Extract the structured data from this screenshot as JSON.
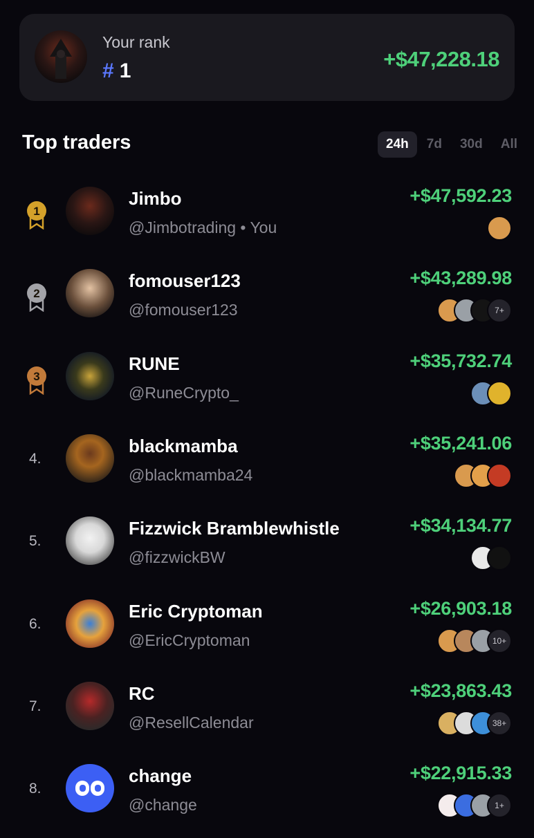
{
  "your_rank": {
    "label": "Your rank",
    "hash": "#",
    "rank": "1",
    "profit": "+$47,228.18"
  },
  "section": {
    "title": "Top traders",
    "tabs": [
      "24h",
      "7d",
      "30d",
      "All"
    ],
    "active_tab": "24h"
  },
  "colors": {
    "profit_green": "#4ed07a",
    "accent_blue": "#5b78ff",
    "gold": "#d4a12a",
    "silver": "#a3a3a8",
    "bronze": "#c27a3a"
  },
  "traders": [
    {
      "rank": "1",
      "medal": "gold",
      "name": "Jimbo",
      "handle": "@Jimbotrading • You",
      "profit": "+$47,592.23",
      "tokens": [
        "dog-token"
      ],
      "more": ""
    },
    {
      "rank": "2",
      "medal": "silver",
      "name": "fomouser123",
      "handle": "@fomouser123",
      "profit": "+$43,289.98",
      "tokens": [
        "dog-token",
        "cat-token",
        "fire-token"
      ],
      "more": "7+"
    },
    {
      "rank": "3",
      "medal": "bronze",
      "name": "RUNE",
      "handle": "@RuneCrypto_",
      "profit": "+$35,732.74",
      "tokens": [
        "bird-token",
        "coin-token"
      ],
      "more": ""
    },
    {
      "rank": "4.",
      "medal": "",
      "name": "blackmamba",
      "handle": "@blackmamba24",
      "profit": "+$35,241.06",
      "tokens": [
        "dog-token",
        "shiba-token",
        "red-token"
      ],
      "more": ""
    },
    {
      "rank": "5.",
      "medal": "",
      "name": "Fizzwick Bramblewhistle",
      "handle": "@fizzwickBW",
      "profit": "+$34,134.77",
      "tokens": [
        "checker-token",
        "ring-token"
      ],
      "more": ""
    },
    {
      "rank": "6.",
      "medal": "",
      "name": "Eric Cryptoman",
      "handle": "@EricCryptoman",
      "profit": "+$26,903.18",
      "tokens": [
        "dog-token",
        "bear-token",
        "cat-token"
      ],
      "more": "10+"
    },
    {
      "rank": "7.",
      "medal": "",
      "name": "RC",
      "handle": "@ResellCalendar",
      "profit": "+$23,863.43",
      "tokens": [
        "doge-token",
        "face-token",
        "minion-token"
      ],
      "more": "38+"
    },
    {
      "rank": "8.",
      "medal": "",
      "name": "change",
      "handle": "@change",
      "profit": "+$22,915.33",
      "tokens": [
        "chart-token",
        "layers-token",
        "cat-token"
      ],
      "more": "1+"
    }
  ]
}
